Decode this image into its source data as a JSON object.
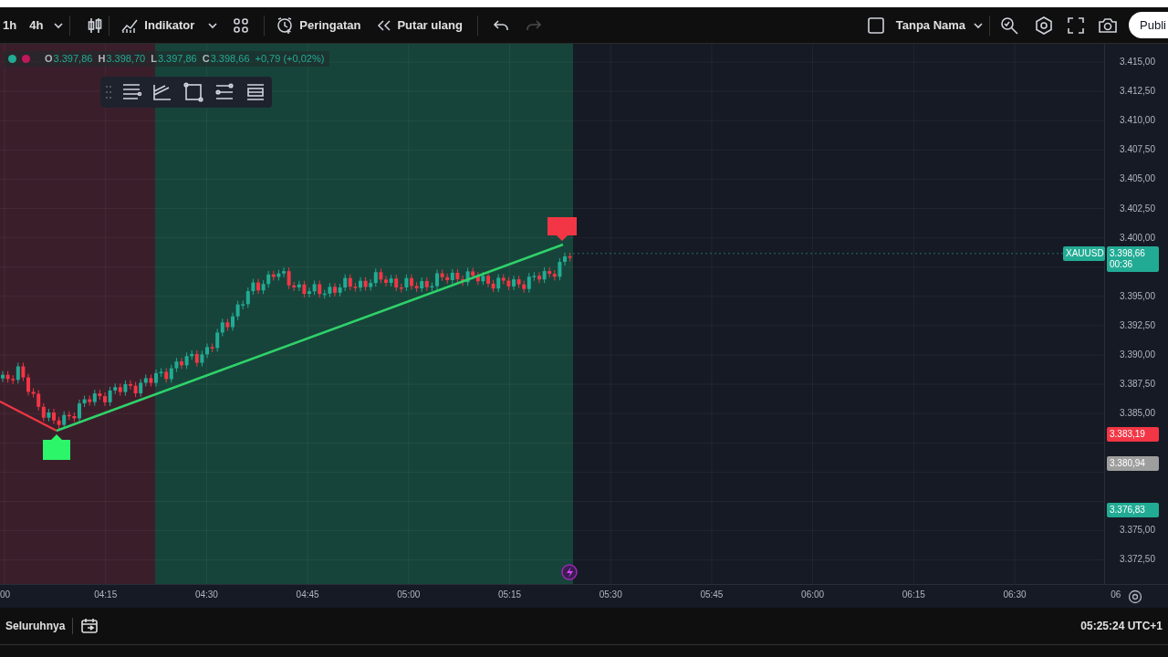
{
  "toolbar": {
    "intervals": [
      {
        "label": "1h",
        "selected": false
      },
      {
        "label": "4h",
        "selected": false
      }
    ],
    "indicator_button": {
      "label": "Indikator"
    },
    "alert_button": {
      "label": "Peringatan"
    },
    "replay_button": {
      "label": "Putar ulang"
    },
    "undo": {
      "disabled": false
    },
    "redo": {
      "disabled": true
    },
    "layout_name": "Tanpa Nama",
    "publish_button": {
      "label": "Publi"
    }
  },
  "legend": {
    "ohlc": [
      {
        "label": "O",
        "value": "3.397,86"
      },
      {
        "label": "H",
        "value": "3.398,70"
      },
      {
        "label": "L",
        "value": "3.397,86"
      },
      {
        "label": "C",
        "value": "3.398,66"
      }
    ],
    "change": "+0,79 (+0,02%)"
  },
  "price_axis": {
    "ticks": [
      "3.415,00",
      "3.412,50",
      "3.410,00",
      "3.407,50",
      "3.405,00",
      "3.402,50",
      "3.400,00",
      "3.395,00",
      "3.392,50",
      "3.390,00",
      "3.387,50",
      "3.385,00",
      "3.375,00",
      "3.372,50"
    ],
    "tags": [
      {
        "text": "XAUUSD",
        "color": "#22ab94"
      },
      {
        "text": "3.398,66",
        "subtext": "00:36",
        "color": "#22ab94"
      },
      {
        "text": "3.383,19",
        "color": "#f23645"
      },
      {
        "text": "3.380,94",
        "color": "#9e9e9e"
      },
      {
        "text": "3.376,83",
        "color": "#22ab94"
      }
    ]
  },
  "time_axis": {
    "ticks": [
      "00",
      "04:15",
      "04:30",
      "04:45",
      "05:00",
      "05:15",
      "05:30",
      "05:45",
      "06:00",
      "06:15",
      "06:30",
      "06"
    ]
  },
  "bottom_bar": {
    "range": "Seluruhnya",
    "clock": "05:25:24 UTC+1"
  }
}
